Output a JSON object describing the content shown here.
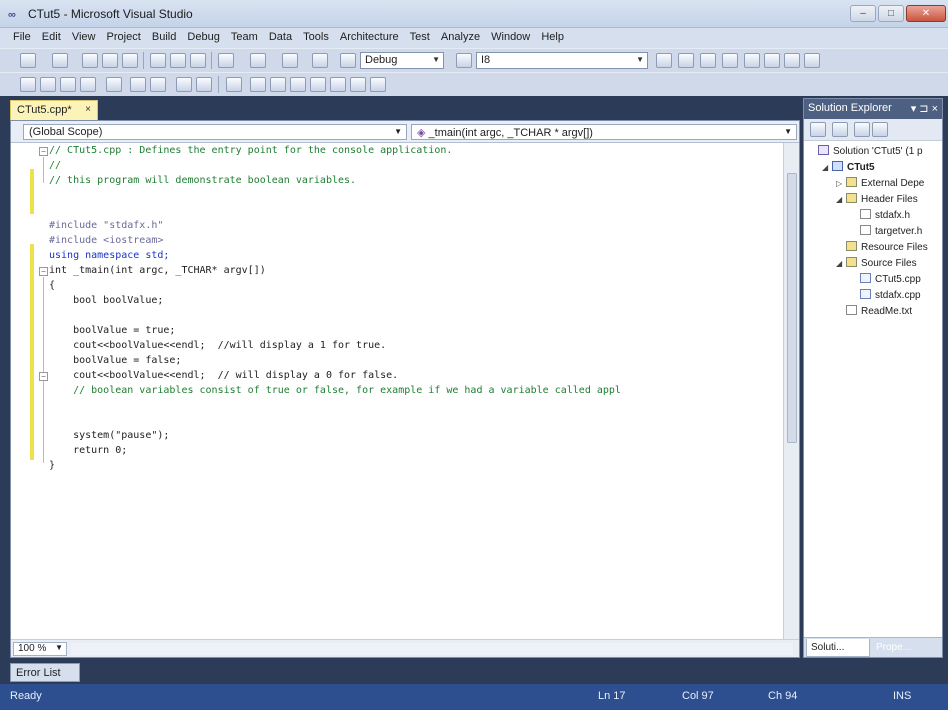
{
  "window": {
    "app_icon": "∞",
    "title": "CTut5 - Microsoft Visual Studio"
  },
  "menu": [
    "File",
    "Edit",
    "View",
    "Project",
    "Build",
    "Debug",
    "Team",
    "Data",
    "Tools",
    "Architecture",
    "Test",
    "Analyze",
    "Window",
    "Help"
  ],
  "toolbar": {
    "config_value": "Debug",
    "find_value": "I8"
  },
  "document_tab": {
    "label": "CTut5.cpp*",
    "close_glyph": "×"
  },
  "nav": {
    "scope": "(Global Scope)",
    "member": "_tmain(int argc, _TCHAR * argv[])"
  },
  "code": [
    "// CTut5.cpp : Defines the entry point for the console application.",
    "//",
    "// this program will demonstrate boolean variables.",
    "",
    "",
    "#include \"stdafx.h\"",
    "#include <iostream>",
    "using namespace std;",
    "int _tmain(int argc, _TCHAR* argv[])",
    "{",
    "    bool boolValue;",
    "",
    "    boolValue = true;",
    "    cout<<boolValue<<endl;  //will display a 1 for true.",
    "    boolValue = false;",
    "    cout<<boolValue<<endl;  // will display a 0 for false.",
    "    // boolean variables consist of true or false, for example if we had a variable called appl",
    "",
    "",
    "    system(\"pause\");",
    "    return 0;",
    "}"
  ],
  "editor": {
    "zoom": "100 %"
  },
  "solution_explorer": {
    "title": "Solution Explorer",
    "header_glyphs": "▾ ⊐ ×",
    "nodes": [
      {
        "label": "Solution 'CTut5' (1 p",
        "level": 0,
        "icon": "solution-icon",
        "expander": ""
      },
      {
        "label": "CTut5",
        "level": 1,
        "icon": "project-icon",
        "expander": "◢",
        "bold": true
      },
      {
        "label": "External Depe",
        "level": 2,
        "icon": "folder-icon",
        "expander": "▷"
      },
      {
        "label": "Header Files",
        "level": 2,
        "icon": "folder-icon",
        "expander": "◢"
      },
      {
        "label": "stdafx.h",
        "level": 3,
        "icon": "header-file-icon",
        "expander": ""
      },
      {
        "label": "targetver.h",
        "level": 3,
        "icon": "header-file-icon",
        "expander": ""
      },
      {
        "label": "Resource Files",
        "level": 2,
        "icon": "folder-icon",
        "expander": ""
      },
      {
        "label": "Source Files",
        "level": 2,
        "icon": "folder-icon",
        "expander": "◢"
      },
      {
        "label": "CTut5.cpp",
        "level": 3,
        "icon": "cpp-file-icon",
        "expander": ""
      },
      {
        "label": "stdafx.cpp",
        "level": 3,
        "icon": "cpp-file-icon",
        "expander": ""
      },
      {
        "label": "ReadMe.txt",
        "level": 2,
        "icon": "text-file-icon",
        "expander": ""
      }
    ],
    "tab_solution": "Soluti...",
    "tab_properties": "Prope..."
  },
  "bottom": {
    "error_list_tab": "Error List"
  },
  "status": {
    "ready": "Ready",
    "line": "Ln 17",
    "col": "Col 97",
    "ch": "Ch 94",
    "mode": "INS"
  }
}
